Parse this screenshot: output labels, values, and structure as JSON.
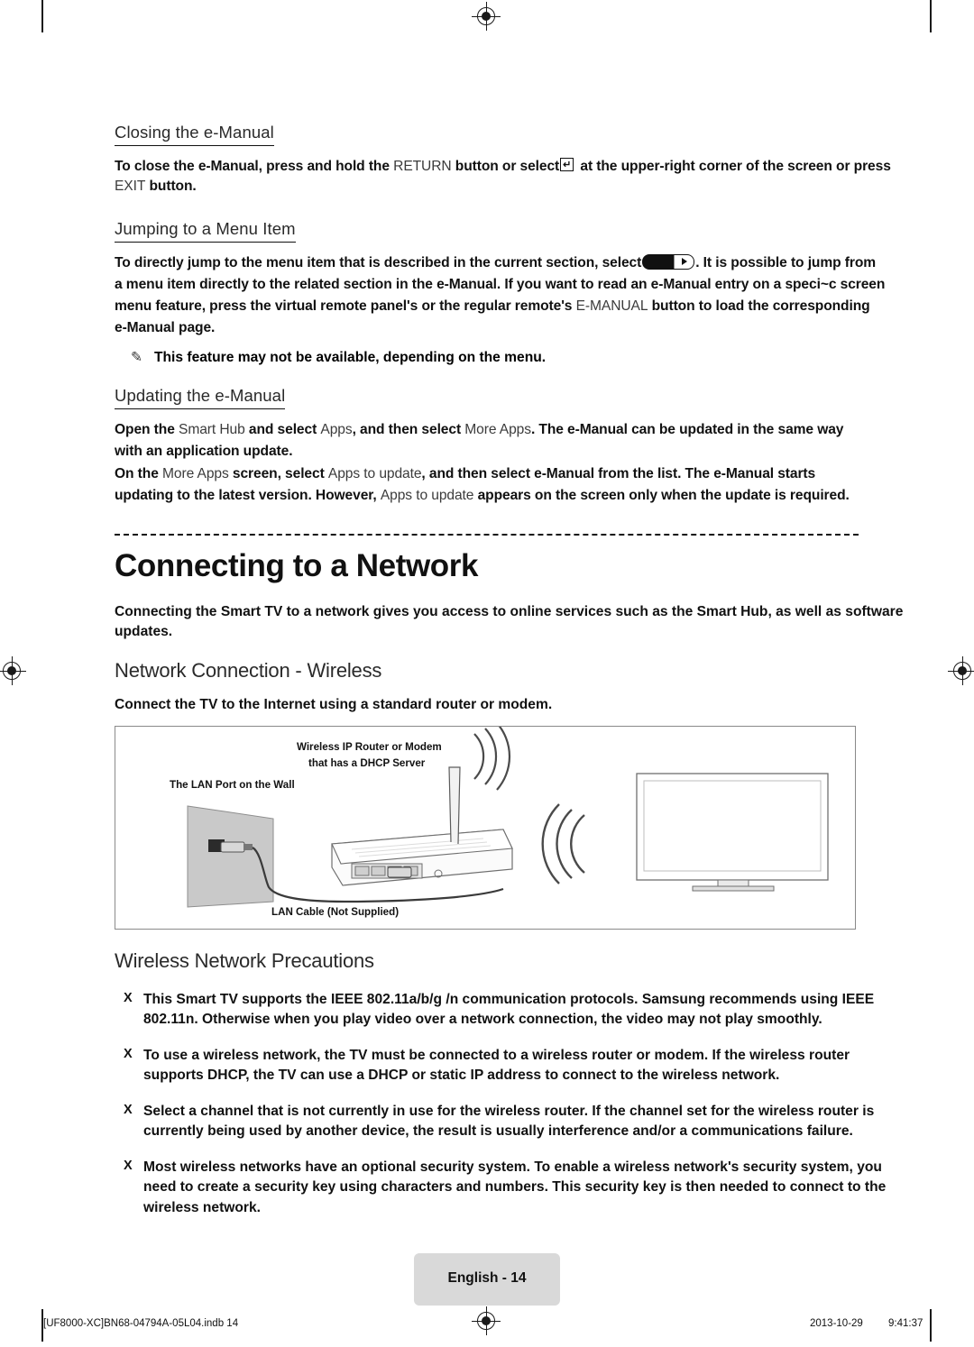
{
  "document": {
    "sections": [
      {
        "heading": "Closing the e-Manual",
        "paragraphs": [
          "To close the e-Manual, press and hold the RETURN button or select  at the upper-right corner of the screen or press EXIT button."
        ]
      },
      {
        "heading": "Jumping to a Menu Item",
        "paragraphs": [
          "To directly jump to the menu item that is described in the current section, select  . It is possible to jump from a menu item directly to the related section in the e-Manual. If you want to read an e-Manual entry on a speci~c screen menu feature, press the virtual remote panel's or the regular remote's E-MANUAL button to load the corresponding e-Manual page."
        ],
        "note": "This feature may not be available, depending on the menu."
      },
      {
        "heading": "Updating the e-Manual",
        "paragraphs": [
          "Open the Smart Hub and select Apps, and then select More Apps. The e-Manual can be updated in the same way with an application update.",
          "On the More Apps screen, select Apps to update, and then select e-Manual from the list. The e-Manual starts updating to the latest version. However, Apps to update appears on the screen only when the update is required."
        ]
      }
    ],
    "chapter": {
      "title": "Connecting to a Network",
      "intro": "Connecting the Smart TV to a network gives you access to online services such as the Smart Hub, as well as software updates.",
      "subsection_title": "Network Connection - Wireless",
      "subsection_intro": "Connect the TV to the Internet using a standard router or modem."
    },
    "figure": {
      "labels": {
        "router_line1": "Wireless IP Router or Modem",
        "router_line2": "that has a DHCP Server",
        "lan_port": "The LAN Port on the Wall",
        "lan_cable": "LAN Cable (Not Supplied)"
      }
    },
    "precautions": {
      "title": "Wireless Network Precautions",
      "bullet_mark": "X",
      "items": [
        "This Smart TV supports the IEEE 802.11a/b/g /n communication protocols. Samsung recommends using IEEE 802.11n. Otherwise when you play video over a network connection, the video may not play smoothly.",
        "To use a wireless network, the TV must be connected to a wireless router or modem. If the wireless router supports DHCP, the TV can use a DHCP or static IP address to connect to the wireless network.",
        "Select a channel that is not currently in use for the wireless router. If the channel set for the wireless router is currently being used by another device, the result is usually interference and/or a communications failure.",
        "Most wireless networks have an optional security system. To enable a wireless network's security system, you need to create a security key using characters and numbers. This security key is then needed to connect to the wireless network."
      ]
    },
    "footer": {
      "page_label": "English - 14",
      "file_info": "[UF8000-XC]BN68-04794A-05L04.indb   14",
      "date": "2013-10-29",
      "time": "9:41:37"
    },
    "inline_text": {
      "closing_p1_a": "To close the e-Manual, press and hold the ",
      "closing_p1_return": "RETURN",
      "closing_p1_b": " button or select",
      "closing_p1_c": " at the upper-right corner of the screen or press ",
      "closing_p1_exit": "EXIT",
      "closing_p1_d": " button.",
      "jump_a": "To directly jump to the menu item that is described in the current section, select",
      "jump_b": ". It is possible to jump from",
      "jump_line2": "a menu item directly to the related section in the e-Manual. If you want to read an e-Manual entry on a speci~c screen",
      "jump_line3_a": "menu feature, press the virtual remote panel's or the regular remote's ",
      "jump_line3_emanual": "E-MANUAL",
      "jump_line3_b": " button to load the corresponding",
      "jump_line4": "e-Manual page.",
      "note_mark": "✎",
      "upd_l1_a": "Open the ",
      "upd_l1_smarthub": "Smart Hub",
      "upd_l1_b": " and select ",
      "upd_l1_apps": "Apps",
      "upd_l1_c": ", and then select ",
      "upd_l1_moreapps": "More Apps",
      "upd_l1_d": ". The e-Manual can be updated in the same way",
      "upd_l2": "with an application update.",
      "upd_l3_a": "On the ",
      "upd_l3_moreapps": "More Apps",
      "upd_l3_b": " screen, select ",
      "upd_l3_appstoupdate": "Apps to update",
      "upd_l3_c": ", and then select e-Manual from the list. The e-Manual starts",
      "upd_l4_a": "updating to the latest version. However, ",
      "upd_l4_appstoupdate": "Apps to update",
      "upd_l4_b": " appears on the screen only when the update is required."
    }
  }
}
